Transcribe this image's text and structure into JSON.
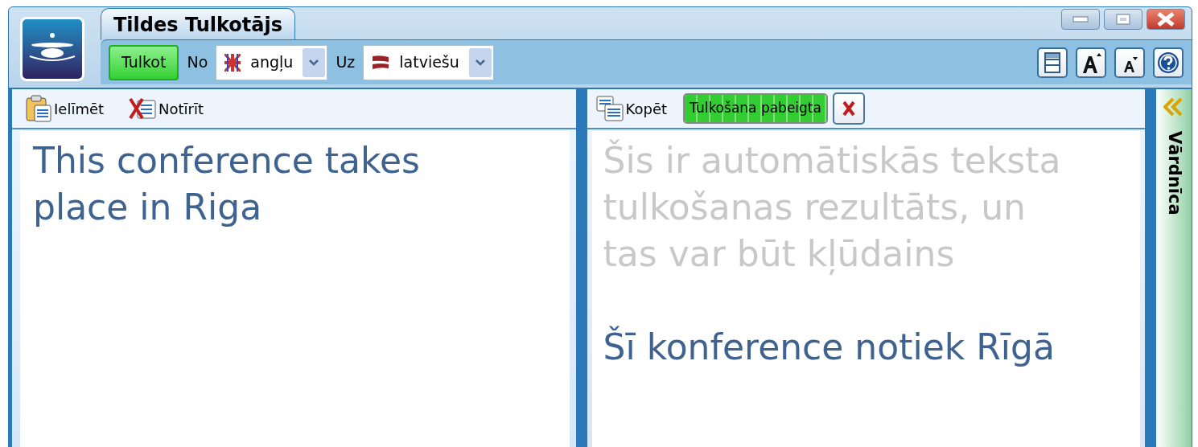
{
  "window": {
    "title": "Tildes Tulkotājs"
  },
  "toolbar": {
    "translate_button": "Tulkot",
    "from_label": "No",
    "from_language": "angļu",
    "to_label": "Uz",
    "to_language": "latviešu"
  },
  "source_panel": {
    "actions": [
      "Ielīmēt",
      "Notīrīt"
    ],
    "text": "This conference takes place in Riga"
  },
  "target_panel": {
    "copy": "Kopēt",
    "progress": {
      "label": "Tulkošana pabeigta",
      "level": 1
    },
    "disclaimer": "Šis ir automātiskās teksta tulkošanas rezultāts, un tas var būt kļūdains",
    "text": "Šī konference notiek Rīgā"
  },
  "side_tab": {
    "label": "Vārdnīca",
    "expanded": false
  }
}
